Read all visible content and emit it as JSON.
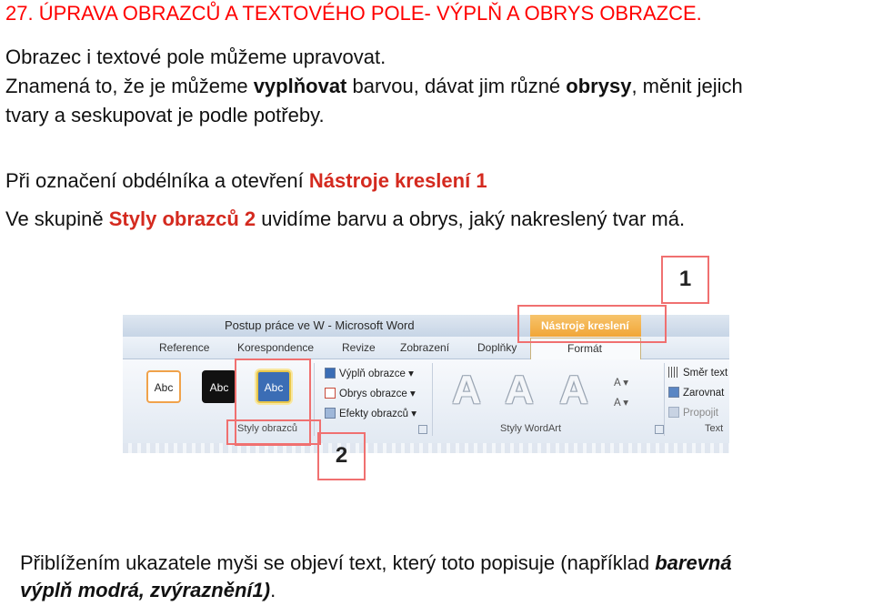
{
  "heading": "27. ÚPRAVA OBRAZCŮ A TEXTOVÉHO POLE-  VÝPLŇ A OBRYS  OBRAZCE.",
  "para1": {
    "line1": "Obrazec i textové pole můžeme upravovat.",
    "line2_a": "Znamená to, že je můžeme ",
    "line2_b": "vyplňovat",
    "line2_c": " barvou, dávat jim různé ",
    "line2_d": "obrysy",
    "line2_e": ", měnit jejich",
    "line3": "tvary a seskupovat je podle potřeby."
  },
  "para2": {
    "line1_a": "Při označení obdélníka a otevření ",
    "line1_b": "Nástroje kreslení 1",
    "line2_a": "Ve skupině ",
    "line2_b": "Styly obrazců 2",
    "line2_c": " uvidíme barvu a obrys, jaký  nakreslený tvar má."
  },
  "callouts": {
    "one": "1",
    "two": "2"
  },
  "ribbon": {
    "window_title": "Postup práce ve W  -  Microsoft Word",
    "context_tab": "Nástroje kreslení",
    "tabs": [
      "Reference",
      "Korespondence",
      "Revize",
      "Zobrazení",
      "Doplňky",
      "Formát"
    ],
    "swatch_labels": [
      "Abc",
      "Abc",
      "Abc"
    ],
    "shape_fill": "Výplň obrazce",
    "shape_outline": "Obrys obrazce",
    "shape_effects": "Efekty obrazců",
    "group_shape_styles": "Styly obrazců",
    "wordart_glyphs": [
      "A",
      "A",
      "A"
    ],
    "group_wordart": "Styly WordArt",
    "text_direction": "Směr text",
    "align": "Zarovnat",
    "link": "Propojit",
    "group_text": "Text"
  },
  "footer": {
    "line1_a": "Přiblížením ukazatele myši se objeví text, který toto popisuje (například ",
    "line1_b": "barevná",
    "line2_a": "výplň modrá, zvýraznění1)",
    "line2_b": "."
  },
  "colors": {
    "heading": "#ff0000",
    "highlight": "#d42a1f",
    "callout_border": "#f07070",
    "accent_blue": "#3b6db5"
  }
}
